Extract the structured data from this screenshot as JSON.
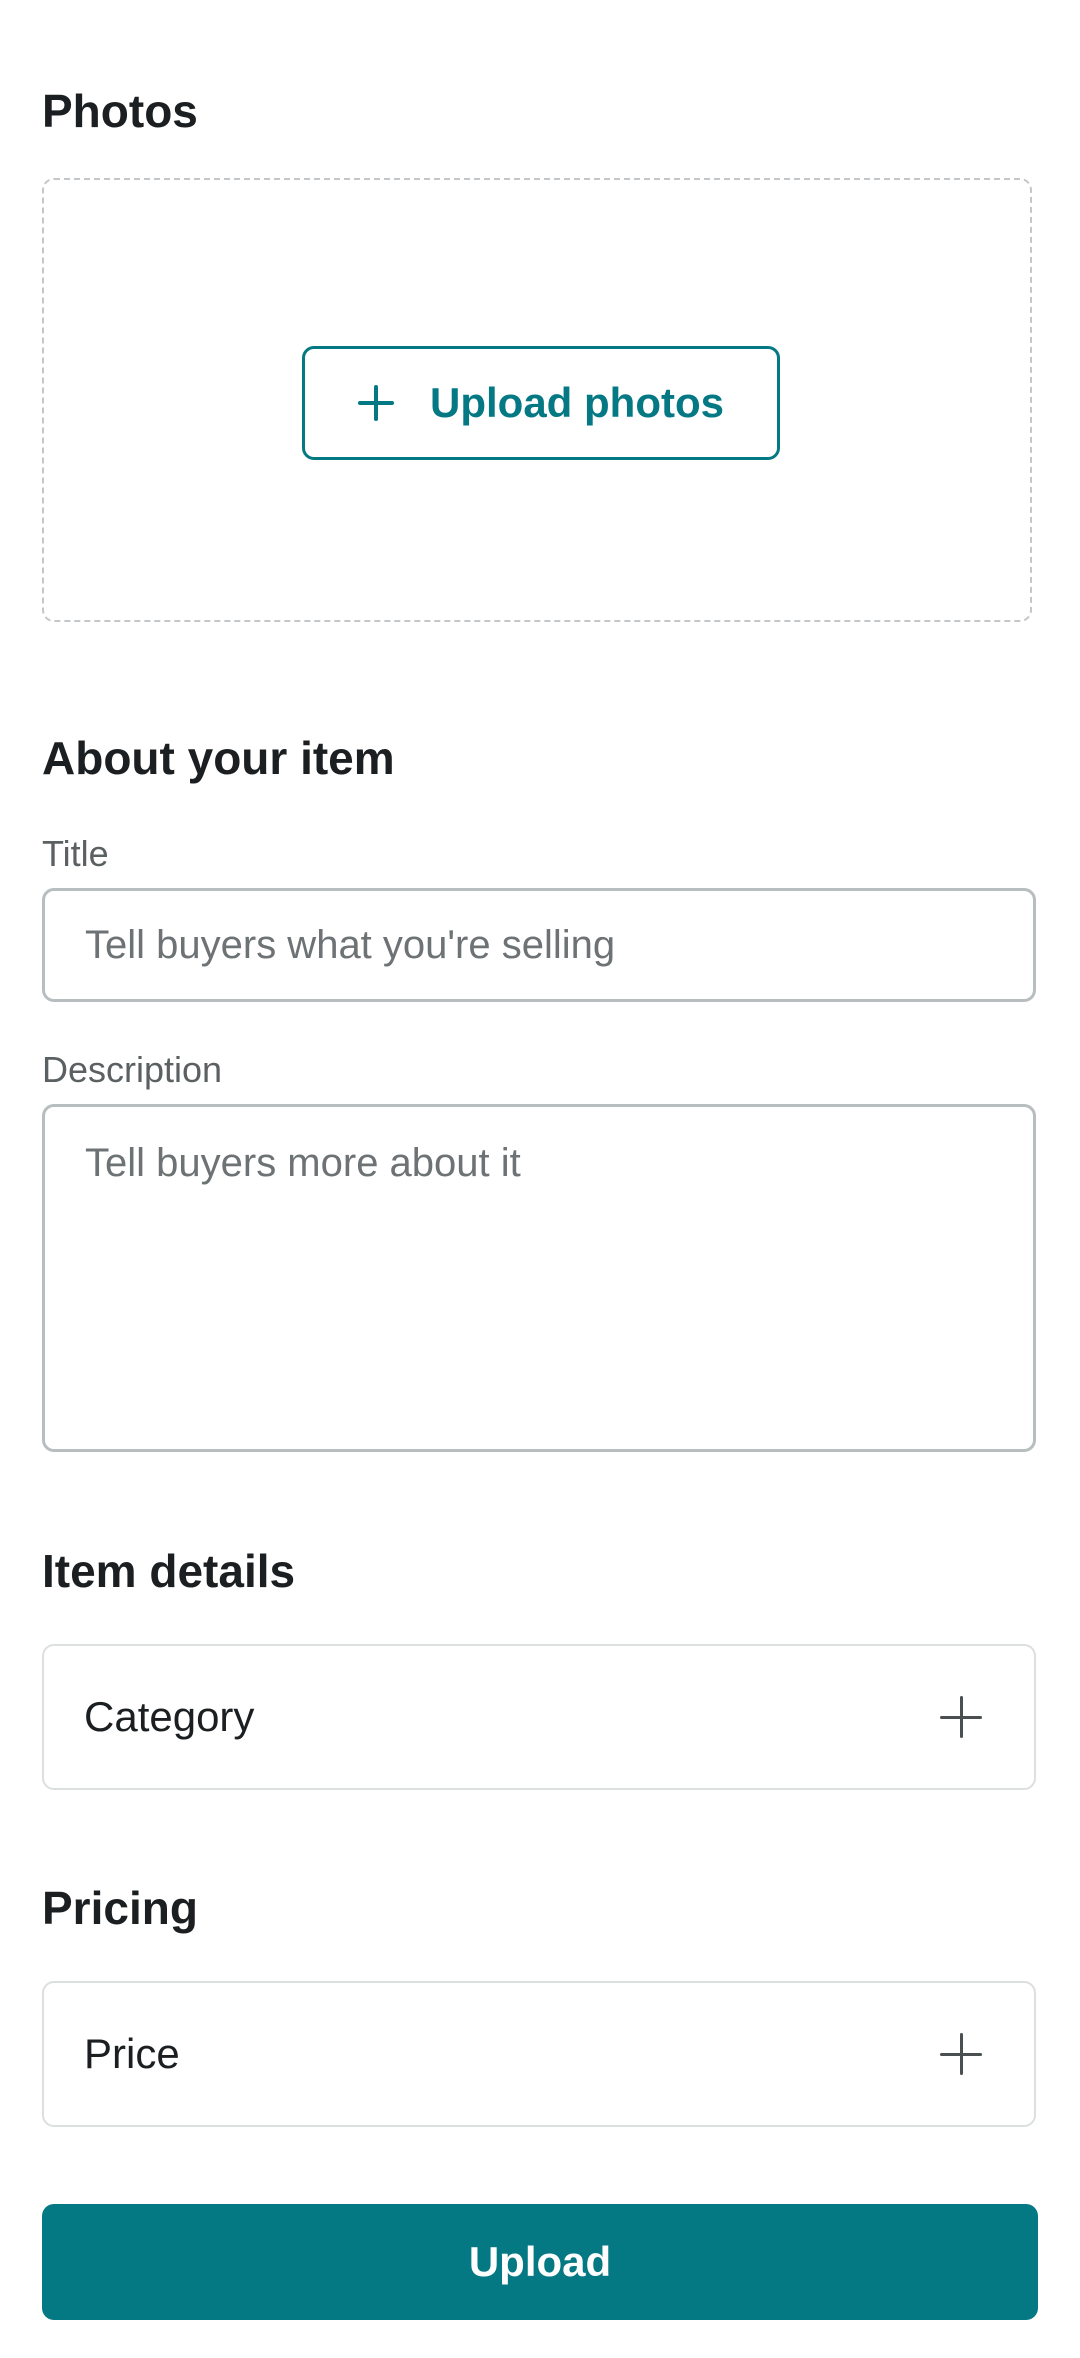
{
  "photos": {
    "heading": "Photos",
    "upload_button_label": "Upload photos",
    "upload_button_icon": "plus-icon"
  },
  "about": {
    "heading": "About your item",
    "title_label": "Title",
    "title_placeholder": "Tell buyers what you're selling",
    "title_value": "",
    "description_label": "Description",
    "description_placeholder": "Tell buyers more about it",
    "description_value": ""
  },
  "item_details": {
    "heading": "Item details",
    "category_label": "Category",
    "category_icon": "plus-icon"
  },
  "pricing": {
    "heading": "Pricing",
    "price_label": "Price",
    "price_icon": "plus-icon"
  },
  "submit": {
    "label": "Upload"
  },
  "colors": {
    "accent": "#047983",
    "text": "#1c1f21",
    "muted_text": "#5b6063",
    "border": "#b8bdbf"
  }
}
